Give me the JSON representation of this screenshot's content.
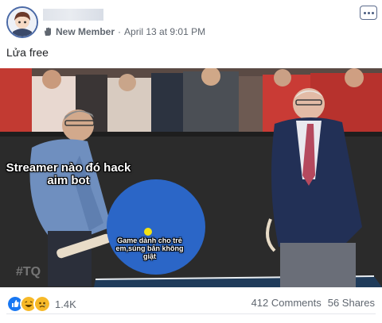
{
  "post": {
    "author_name": "",
    "badge_label": "New Member",
    "timestamp": "April 13 at 9:01 PM",
    "text": "Lửa free",
    "more_icon": "more-options-icon"
  },
  "image": {
    "caption_top": "Streamer nào đó hack aim bot",
    "caption_paddle": "Game dành cho trẻ em,súng bắn không giật",
    "watermark": "#TQ"
  },
  "footer": {
    "reaction_count": "1.4K",
    "comments": "412 Comments",
    "shares": "56 Shares",
    "reaction_icons": [
      "like-reaction-icon",
      "haha-reaction-icon",
      "sad-reaction-icon"
    ]
  },
  "colors": {
    "like_blue": "#1877f2",
    "haha_yellow": "#f7b928",
    "paddle_blue": "#2b66c7",
    "table_dark": "#1f3b5a"
  }
}
